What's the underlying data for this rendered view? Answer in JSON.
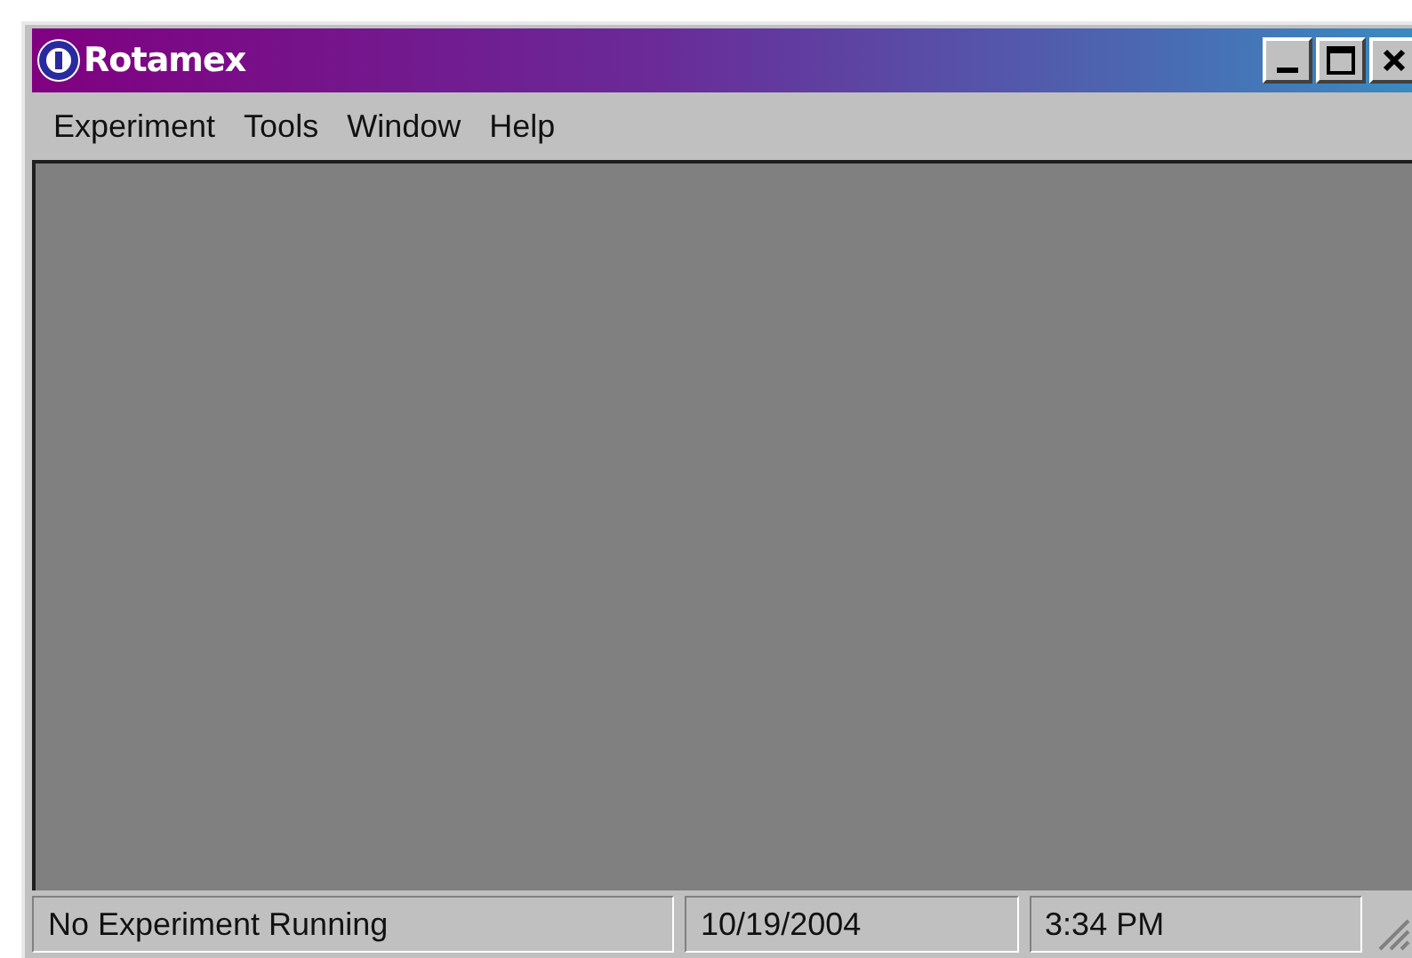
{
  "window": {
    "title": "Rotamex"
  },
  "menu": [
    "Experiment",
    "Tools",
    "Window",
    "Help"
  ],
  "status_bar": [
    "No Experiment Running",
    "10/19/2004",
    "3:34 PM"
  ]
}
